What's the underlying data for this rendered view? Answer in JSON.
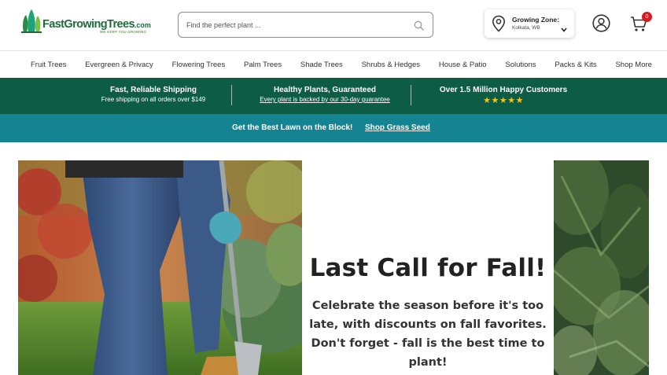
{
  "brand": {
    "logo_name": "FastGrowingTrees",
    "logo_suffix": ".com",
    "tagline": "WE KEEP YOU GROWING"
  },
  "search": {
    "placeholder": "Find the perfect plant ...",
    "icon": "search-icon"
  },
  "zone": {
    "title": "Growing Zone:",
    "location": "Kolkata, WB"
  },
  "cart": {
    "count": "0"
  },
  "nav": {
    "items": [
      {
        "label": "Fruit Trees"
      },
      {
        "label": "Evergreen & Privacy"
      },
      {
        "label": "Flowering Trees"
      },
      {
        "label": "Palm Trees"
      },
      {
        "label": "Shade Trees"
      },
      {
        "label": "Shrubs & Hedges"
      },
      {
        "label": "House & Patio"
      },
      {
        "label": "Solutions"
      },
      {
        "label": "Packs & Kits"
      },
      {
        "label": "Shop More"
      }
    ]
  },
  "benefits": [
    {
      "title": "Fast, Reliable Shipping",
      "subtitle": "Free shipping on all orders over $149"
    },
    {
      "title": "Healthy Plants, Guaranteed",
      "subtitle": "Every plant is backed by our 30-day guarantee"
    },
    {
      "title": "Over 1.5 Million Happy Customers",
      "rating": 5
    }
  ],
  "promo": {
    "text": "Get the Best Lawn on the Block!",
    "link": "Shop Grass Seed"
  },
  "hero": {
    "title": "Last Call for Fall!",
    "body": "Celebrate the season before it's too late, with discounts on fall favorites. Don't forget - fall is the best time to plant!"
  },
  "colors": {
    "brand_green": "#1d6b3b",
    "benefits_bg": "#0d5c45",
    "promo_bg": "#148492",
    "badge_red": "#d71920",
    "star_gold": "#f5c518"
  }
}
